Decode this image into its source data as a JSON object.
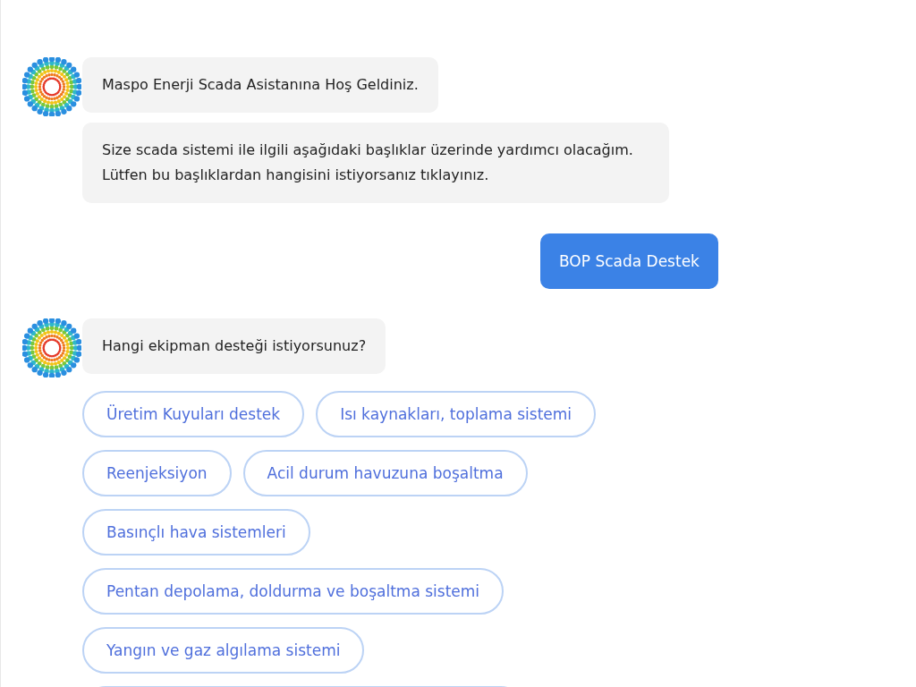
{
  "messages": [
    {
      "kind": "bot",
      "bubbles": [
        "Maspo Enerji Scada Asistanına Hoş Geldiniz.",
        "Size scada sistemi ile ilgili aşağıdaki başlıklar üzerinde yardımcı olacağım. Lütfen bu başlıklardan hangisini istiyorsanız tıklayınız."
      ]
    },
    {
      "kind": "user",
      "text": "BOP Scada Destek"
    },
    {
      "kind": "bot",
      "bubbles": [
        "Hangi ekipman desteği istiyorsunuz?"
      ],
      "options": [
        "Üretim Kuyuları destek",
        "Isı kaynakları, toplama sistemi",
        "Reenjeksiyon",
        "Acil durum havuzuna boşaltma",
        "Basınçlı hava sistemleri",
        "Pentan depolama, doldurma ve boşaltma sistemi",
        "Yangın ve gaz algılama sistemi"
      ]
    }
  ]
}
